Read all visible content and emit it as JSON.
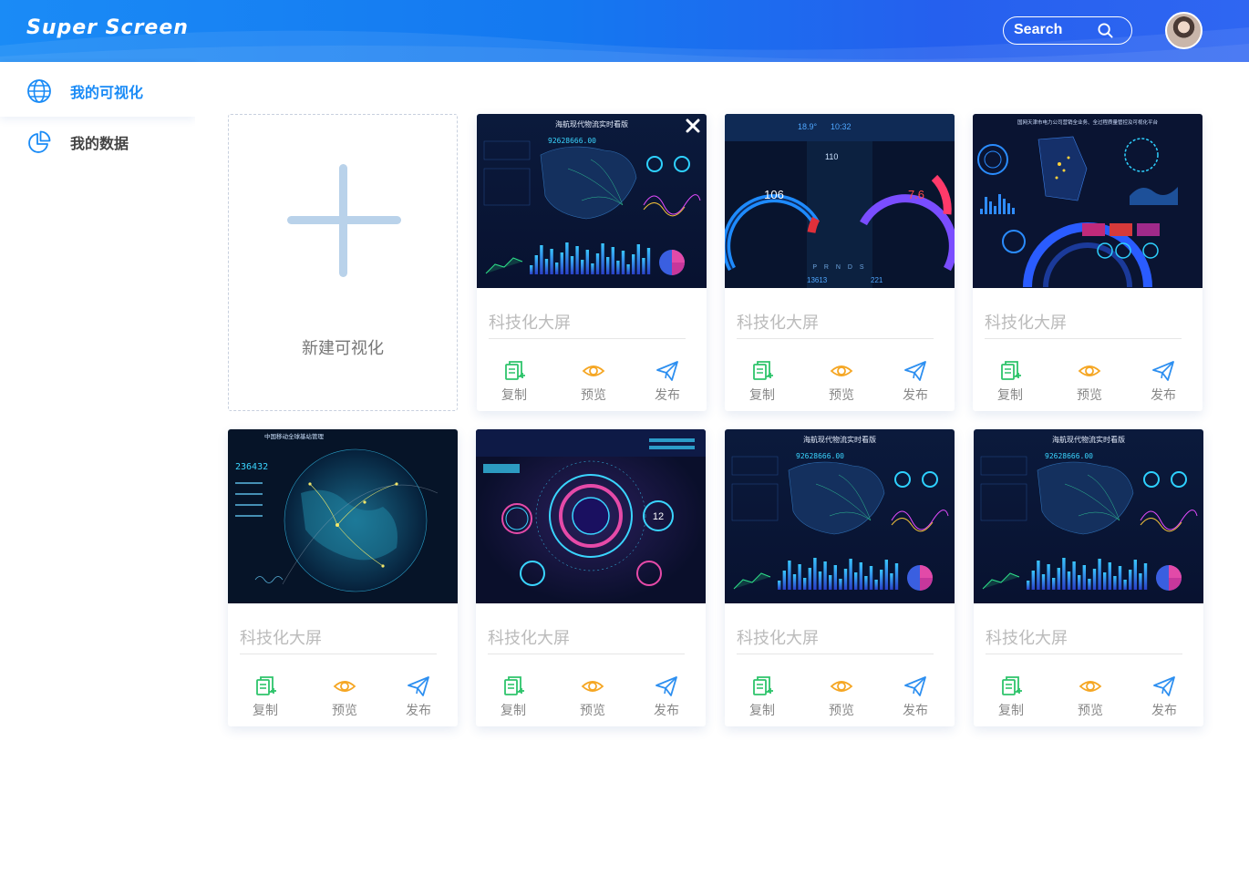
{
  "header": {
    "logo": "Super Screen",
    "search_label": "Search"
  },
  "sidebar": {
    "items": [
      {
        "label": "我的可视化",
        "icon": "globe-icon",
        "active": true
      },
      {
        "label": "我的数据",
        "icon": "pie-chart-icon",
        "active": false
      }
    ]
  },
  "new_card": {
    "label": "新建可视化"
  },
  "actions": {
    "copy": "复制",
    "preview": "预览",
    "publish": "发布"
  },
  "cards": [
    {
      "title": "科技化大屏",
      "thumb": "logistics-dashboard",
      "thumb_title": "海航现代物流实时看版",
      "thumb_value": "92628666.00"
    },
    {
      "title": "科技化大屏",
      "thumb": "car-dashboard",
      "speed": "106",
      "rpm": "7.6",
      "limit": "110",
      "temp": "18.9°",
      "time": "10:32",
      "total": "13613",
      "trip": "221",
      "gears": "P R N D S"
    },
    {
      "title": "科技化大屏",
      "thumb": "power-dashboard",
      "thumb_title": "国网天津市电力公司营销全业务、全过程质量管控及可视化平台"
    },
    {
      "title": "科技化大屏",
      "thumb": "globe-dashboard",
      "thumb_title": "中国移动全球基站管理",
      "thumb_value": "236432"
    },
    {
      "title": "科技化大屏",
      "thumb": "hud-dashboard",
      "thumb_value": "12"
    },
    {
      "title": "科技化大屏",
      "thumb": "logistics-dashboard",
      "thumb_title": "海航现代物流实时看版",
      "thumb_value": "92628666.00"
    },
    {
      "title": "科技化大屏",
      "thumb": "logistics-dashboard",
      "thumb_title": "海航现代物流实时看版",
      "thumb_value": "92628666.00"
    }
  ],
  "colors": {
    "accent": "#1a8bf6",
    "copy_icon": "#2ec46b",
    "preview_icon": "#f5a623",
    "publish_icon": "#2d8ff0"
  }
}
